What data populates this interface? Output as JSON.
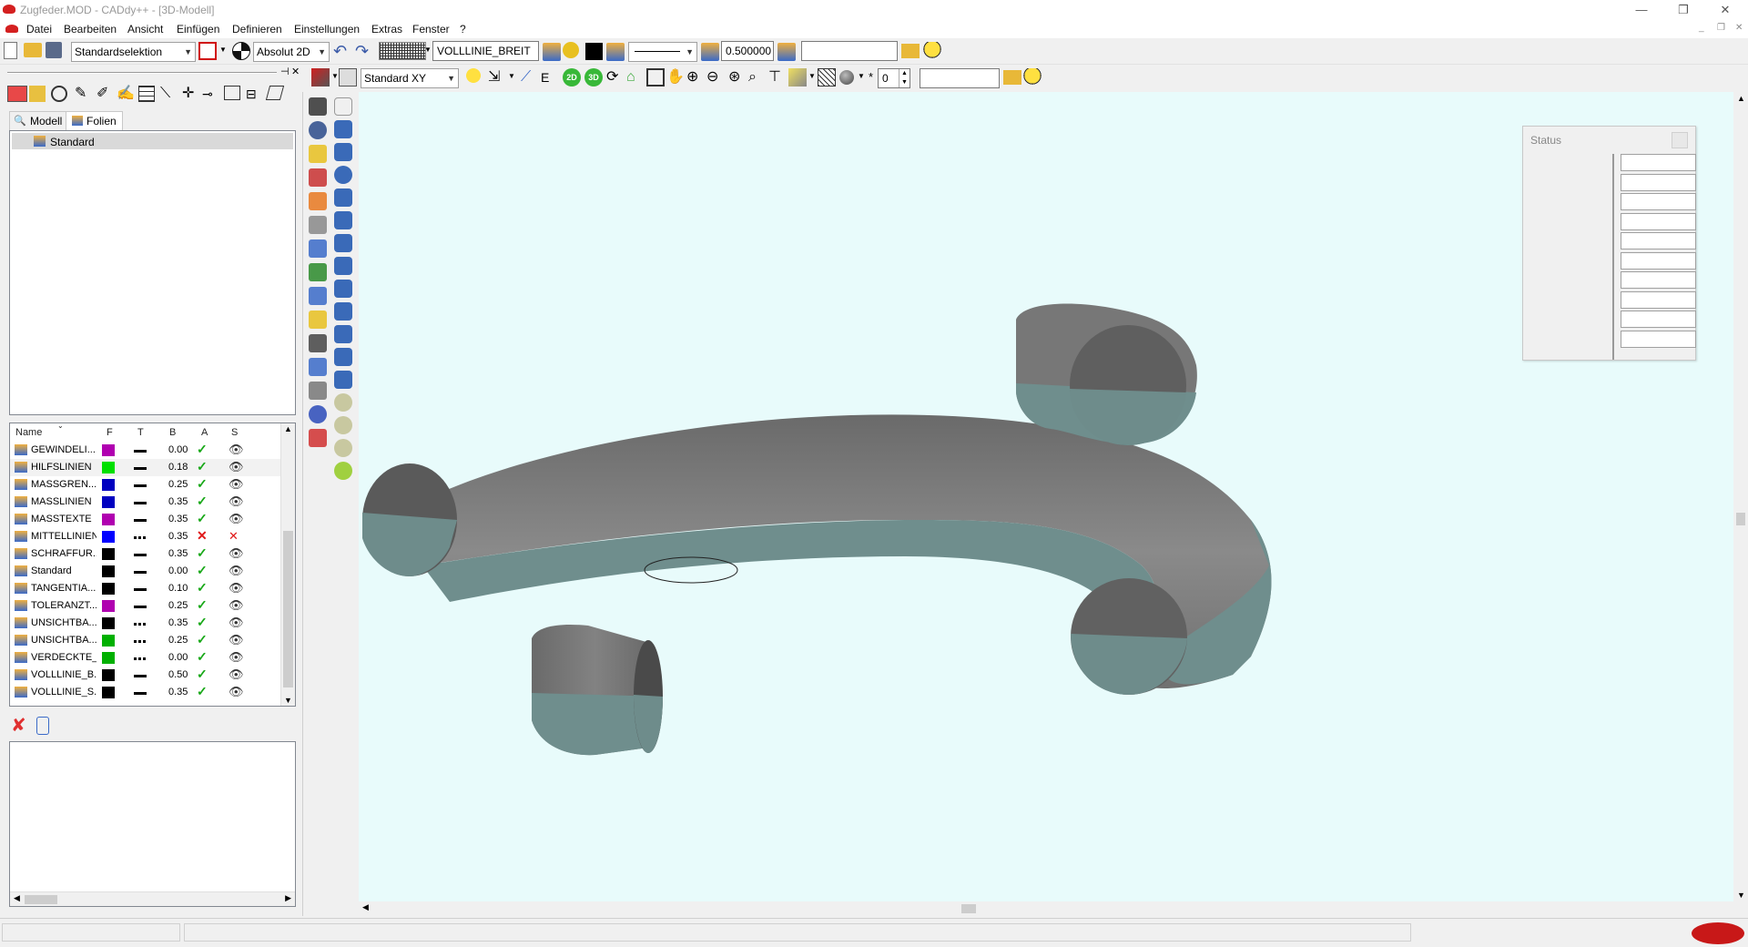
{
  "window": {
    "title": "Zugfeder.MOD - CADdy++ - [3D-Modell]"
  },
  "menu": {
    "items": [
      "Datei",
      "Bearbeiten",
      "Ansicht",
      "Einfügen",
      "Definieren",
      "Einstellungen",
      "Extras",
      "Fenster",
      "?"
    ]
  },
  "toolbar": {
    "selection_mode": "Standardselektion",
    "coord_mode": "Absolut 2D",
    "line_style": "VOLLLINIE_BREIT",
    "line_width": "0.500000",
    "view_plane": "Standard XY",
    "number_value": "0",
    "btn_2d": "2D",
    "btn_3d": "3D"
  },
  "panel": {
    "tabs": [
      "Modell",
      "Folien"
    ],
    "tree_item": "Standard",
    "table_headers": [
      "Name",
      "F",
      "T",
      "B",
      "A",
      "S"
    ],
    "layers": [
      {
        "name": "GEWINDELI...",
        "color": "#b000b0",
        "type": "solid",
        "width": "0.00",
        "active": true,
        "visible": true
      },
      {
        "name": "HILFSLINIEN",
        "color": "#00e000",
        "type": "solid",
        "width": "0.18",
        "active": true,
        "visible": true
      },
      {
        "name": "MASSGREN...",
        "color": "#0000c0",
        "type": "solid",
        "width": "0.25",
        "active": true,
        "visible": true
      },
      {
        "name": "MASSLINIEN",
        "color": "#0000c0",
        "type": "solid",
        "width": "0.35",
        "active": true,
        "visible": true
      },
      {
        "name": "MASSTEXTE",
        "color": "#b000b0",
        "type": "solid",
        "width": "0.35",
        "active": true,
        "visible": true
      },
      {
        "name": "MITTELLINIEN",
        "color": "#0000ff",
        "type": "dash",
        "width": "0.35",
        "active": false,
        "visible": false
      },
      {
        "name": "SCHRAFFUR...",
        "color": "#000000",
        "type": "solid",
        "width": "0.35",
        "active": true,
        "visible": true
      },
      {
        "name": "Standard",
        "color": "#000000",
        "type": "solid",
        "width": "0.00",
        "active": true,
        "visible": true
      },
      {
        "name": "TANGENTIA...",
        "color": "#000000",
        "type": "solid",
        "width": "0.10",
        "active": true,
        "visible": true
      },
      {
        "name": "TOLERANZT...",
        "color": "#b000b0",
        "type": "solid",
        "width": "0.25",
        "active": true,
        "visible": true
      },
      {
        "name": "UNSICHTBA...",
        "color": "#000000",
        "type": "dash",
        "width": "0.35",
        "active": true,
        "visible": true
      },
      {
        "name": "UNSICHTBA...",
        "color": "#00b000",
        "type": "dash",
        "width": "0.25",
        "active": true,
        "visible": true
      },
      {
        "name": "VERDECKTE_...",
        "color": "#00b000",
        "type": "dash",
        "width": "0.00",
        "active": true,
        "visible": true
      },
      {
        "name": "VOLLLINIE_B...",
        "color": "#000000",
        "type": "solid",
        "width": "0.50",
        "active": true,
        "visible": true
      },
      {
        "name": "VOLLLINIE_S...",
        "color": "#000000",
        "type": "solid",
        "width": "0.35",
        "active": true,
        "visible": true
      }
    ]
  },
  "status_window": {
    "title": "Status"
  },
  "colors": {
    "viewport_bg": "#e8fbfb",
    "solid_top": "#7a7a7a",
    "solid_bottom": "#6f8e8d",
    "check": "#18a818",
    "cross": "#e01818"
  }
}
